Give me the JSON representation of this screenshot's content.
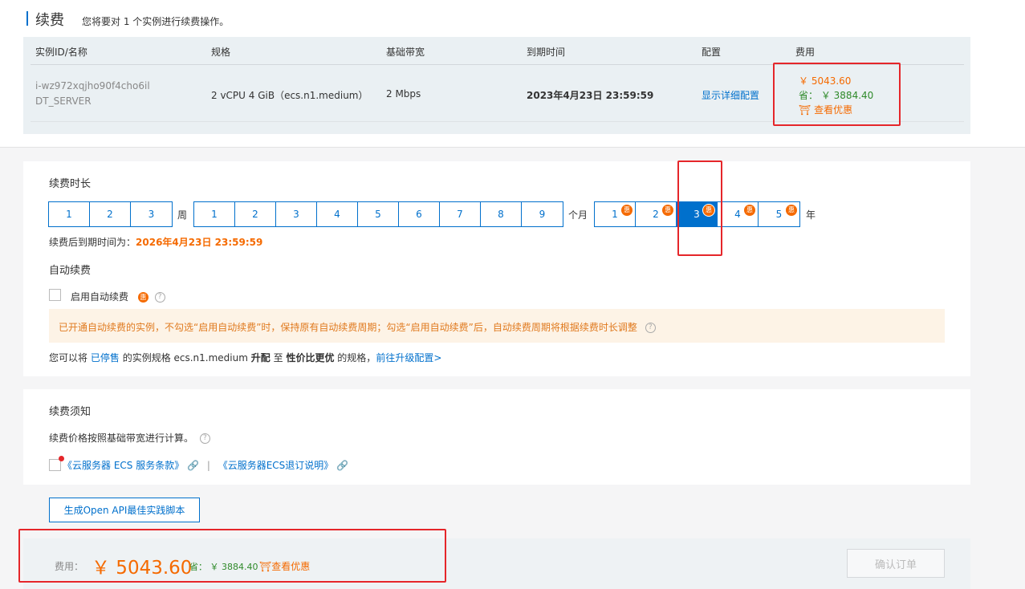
{
  "header": {
    "title": "续费",
    "subtitle": "您将要对 1 个实例进行续费操作。"
  },
  "table": {
    "columns": [
      "实例ID/名称",
      "规格",
      "基础带宽",
      "到期时间",
      "配置",
      "费用"
    ],
    "row": {
      "instance_id": "i-wz972xqjho90f4cho6il",
      "instance_name": "DT_SERVER",
      "spec": "2 vCPU 4 GiB（ecs.n1.medium）",
      "bandwidth": "2 Mbps",
      "expire_time": "2023年4月23日 23:59:59",
      "config_link": "显示详细配置",
      "price": "￥ 5043.60",
      "save_label": "省：",
      "save_amount": "￥ 3884.40",
      "discount_link": "查看优惠"
    }
  },
  "renewal": {
    "duration_label": "续费时长",
    "week_options": [
      "1",
      "2",
      "3"
    ],
    "week_unit": "周",
    "month_options": [
      "1",
      "2",
      "3",
      "4",
      "5",
      "6",
      "7",
      "8",
      "9"
    ],
    "month_unit": "个月",
    "year_options": [
      "1",
      "2",
      "3",
      "4",
      "5"
    ],
    "year_unit": "年",
    "selected_year": "3",
    "discount_badge": "惠",
    "new_expire_label": "续费后到期时间为：",
    "new_expire_value": "2026年4月23日 23:59:59",
    "auto_renew_label": "自动续费",
    "auto_renew_checkbox": "启用自动续费",
    "auto_renew_checked": false,
    "notice_text": "已开通自动续费的实例，不勾选“启用自动续费”时，保持原有自动续费周期；勾选“启用自动续费”后，自动续费周期将根据续费时长调整",
    "upgrade_prefix": "您可以将",
    "upgrade_discontinued": "已停售",
    "upgrade_mid": "的实例规格 ecs.n1.medium",
    "upgrade_bold1": "升配",
    "upgrade_to": "至",
    "upgrade_bold2": "性价比更优",
    "upgrade_suffix": "的规格，",
    "upgrade_link": "前往升级配置>"
  },
  "notes": {
    "title": "续费须知",
    "pricing_text": "续费价格按照基础带宽进行计算。",
    "terms_link1": "《云服务器 ECS 服务条款》",
    "separator": "|",
    "terms_link2": "《云服务器ECS退订说明》"
  },
  "actions": {
    "api_button": "生成Open API最佳实践脚本",
    "confirm_button": "确认订单"
  },
  "footer": {
    "fee_label": "费用：",
    "fee_value": "￥ 5043.60",
    "save_label": "省：",
    "save_amount": "￥ 3884.40",
    "discount_link": "查看优惠"
  },
  "colors": {
    "accent": "#0070cc",
    "price": "#f56a00",
    "save": "#2f8a2a",
    "highlight_box": "#e5262a"
  }
}
